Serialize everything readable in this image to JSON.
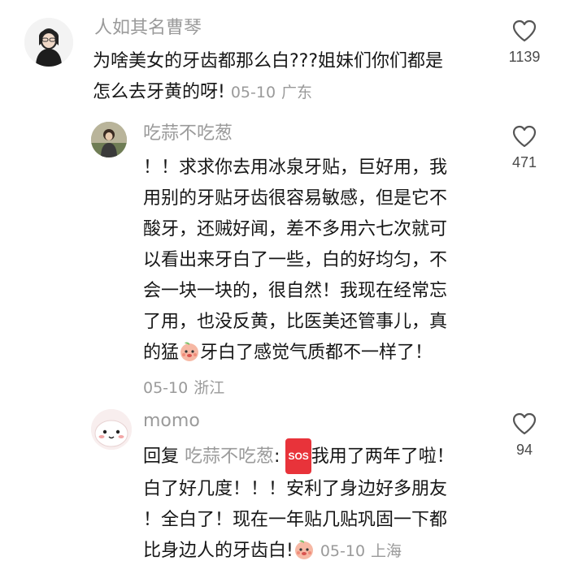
{
  "comments": [
    {
      "username": "人如其名曹琴",
      "lines": [
        "为啥美女的牙齿都那么白???姐妹们你们都是",
        "怎么去牙黄的呀!"
      ],
      "date": "05-10",
      "location": "广东",
      "likes": "1139",
      "avatar_icon": "avatar-girl-photo"
    },
    {
      "username": "吃蒜不吃葱",
      "lines": [
        "！！求求你去用冰泉牙贴，巨好用，我",
        "用别的牙贴牙齿很容易敏感，但是它不",
        "酸牙，还贼好闻，差不多用六七次就可",
        "以看出来牙白了一些，白的好均匀，不",
        "会一块一块的，很自然！我现在经常忘",
        "了用，也没反黄，比医美还管事儿，真"
      ],
      "last_line_before": "的猛",
      "last_line_after": "牙白了感觉气质都不一样了！",
      "date": "05-10",
      "location": "浙江",
      "likes": "471",
      "avatar_icon": "avatar-person-photo"
    },
    {
      "username": "momo",
      "reply_prefix": "回复",
      "reply_to": "吃蒜不吃葱",
      "reply_colon": ":",
      "sos_label": "SOS",
      "first_line_rest": "我用了两年了啦！",
      "lines": [
        "白了好几度！！！安利了身边好多朋友",
        "！全白了！现在一年贴几贴巩固一下都"
      ],
      "last_line": "比身边人的牙齿白!",
      "date": "05-10",
      "location": "上海",
      "likes": "94",
      "avatar_icon": "avatar-cartoon-face"
    }
  ],
  "icons": {
    "like": "heart-outline-icon",
    "emoji": "peach-face-emoji"
  },
  "colors": {
    "text": "#161616",
    "muted": "#9a9a9a",
    "like_count": "#4a4a4a",
    "sos": "#e8333a"
  }
}
